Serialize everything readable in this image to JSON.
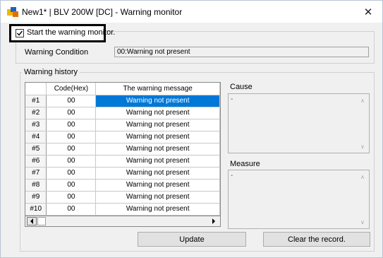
{
  "window": {
    "title": "New1* | BLV 200W [DC] - Warning monitor",
    "close_icon": "close-icon",
    "app_icon": "app-icon"
  },
  "monitor": {
    "checkbox_label": "Start the warning monitor.",
    "checked": true
  },
  "condition": {
    "label": "Warning Condition",
    "value": "00:Warning not present"
  },
  "history": {
    "legend": "Warning history",
    "columns": [
      "Code(Hex)",
      "The warning message"
    ],
    "rows": [
      {
        "id": "#1",
        "code": "00",
        "message": "Warning not present",
        "selected": true
      },
      {
        "id": "#2",
        "code": "00",
        "message": "Warning not present"
      },
      {
        "id": "#3",
        "code": "00",
        "message": "Warning not present"
      },
      {
        "id": "#4",
        "code": "00",
        "message": "Warning not present"
      },
      {
        "id": "#5",
        "code": "00",
        "message": "Warning not present"
      },
      {
        "id": "#6",
        "code": "00",
        "message": "Warning not present"
      },
      {
        "id": "#7",
        "code": "00",
        "message": "Warning not present"
      },
      {
        "id": "#8",
        "code": "00",
        "message": "Warning not present"
      },
      {
        "id": "#9",
        "code": "00",
        "message": "Warning not present"
      },
      {
        "id": "#10",
        "code": "00",
        "message": "Warning not present"
      }
    ]
  },
  "cause": {
    "label": "Cause",
    "value": "-"
  },
  "measure": {
    "label": "Measure",
    "value": "-"
  },
  "buttons": {
    "update": "Update",
    "clear": "Clear the record."
  },
  "colors": {
    "selection": "#0078d7",
    "frame_highlight": "#000000"
  }
}
